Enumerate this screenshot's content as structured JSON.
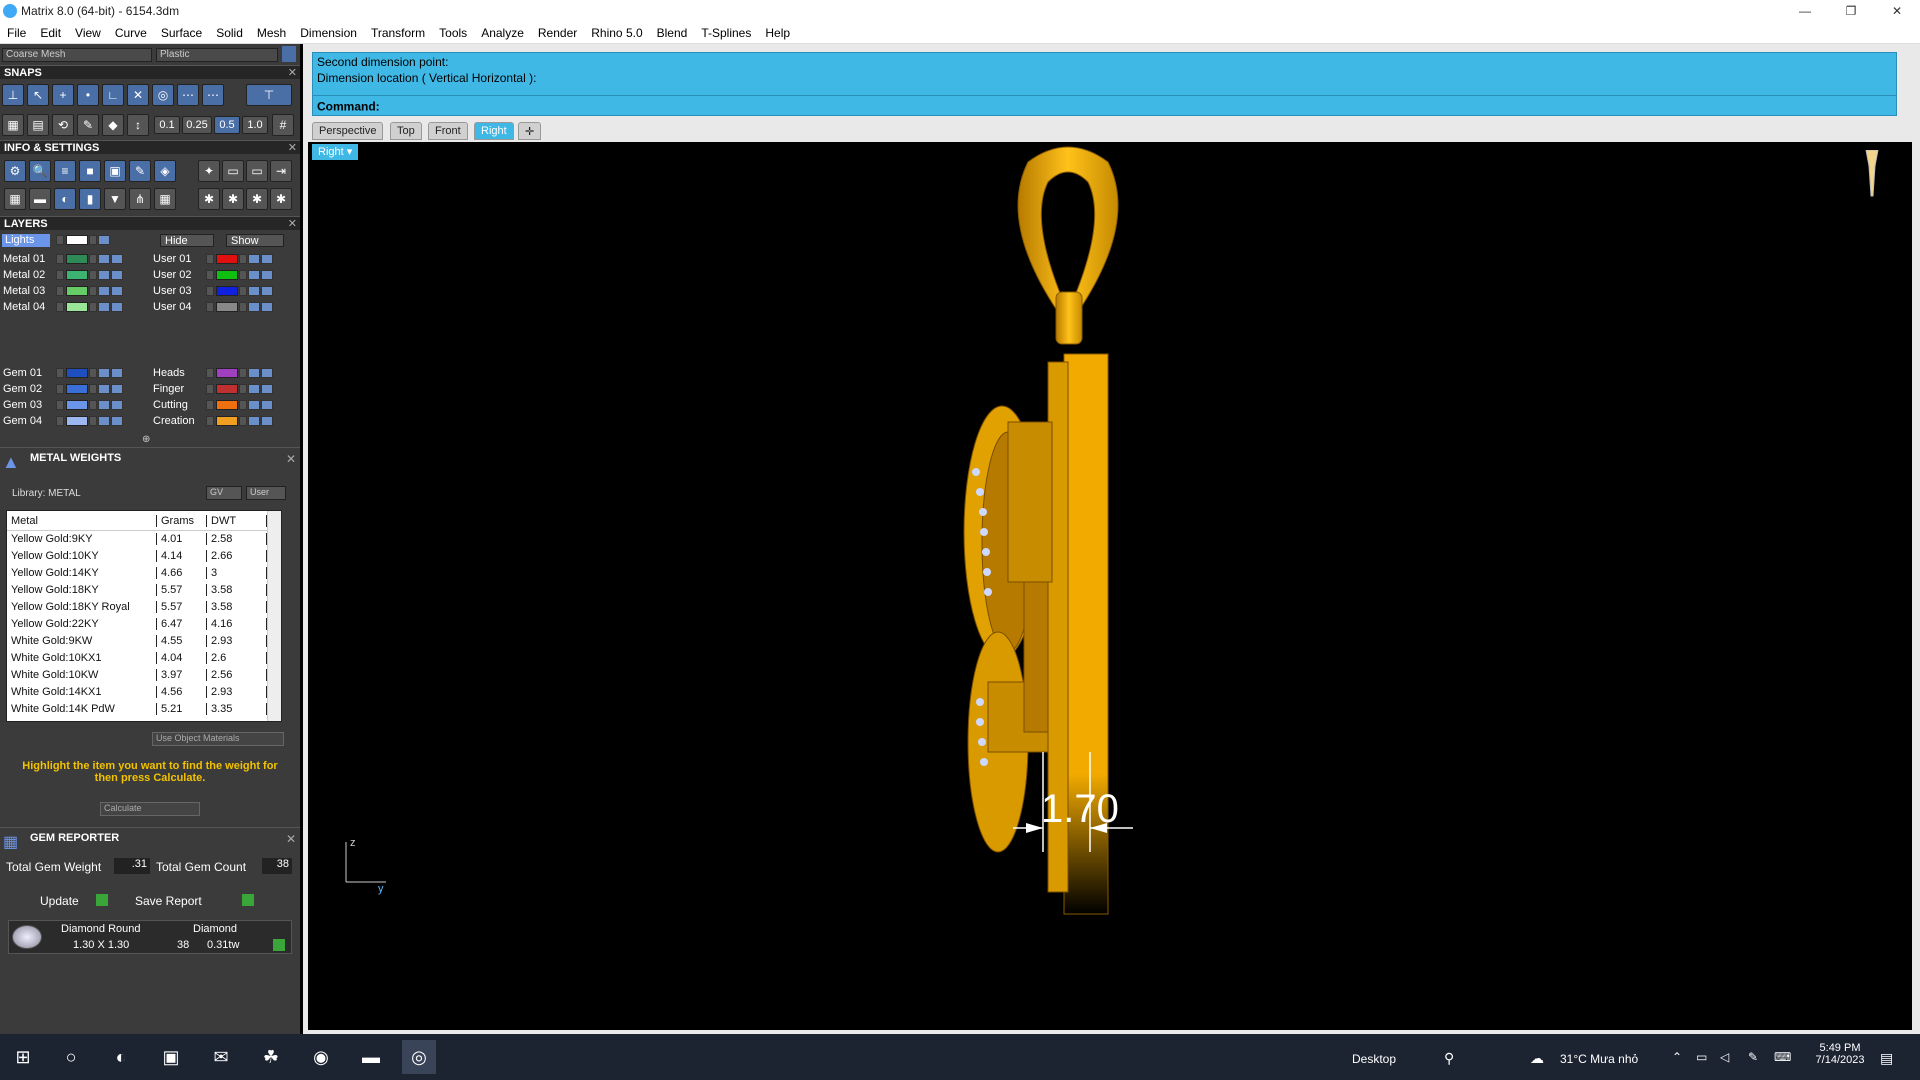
{
  "window": {
    "title": "Matrix 8.0 (64-bit) - 6154.3dm"
  },
  "menu": [
    "File",
    "Edit",
    "View",
    "Curve",
    "Surface",
    "Solid",
    "Mesh",
    "Dimension",
    "Transform",
    "Tools",
    "Analyze",
    "Render",
    "Rhino 5.0",
    "Blend",
    "T-Splines",
    "Help"
  ],
  "top_dropdowns": {
    "mesh": "Coarse Mesh",
    "material": "Plastic"
  },
  "sections": {
    "snaps": "SNAPS",
    "info": "INFO & SETTINGS",
    "layers": "LAYERS",
    "metal_weights": "METAL WEIGHTS",
    "gem_reporter": "GEM REPORTER"
  },
  "snaps": {
    "values": [
      "0.1",
      "0.25",
      "0.5",
      "1.0"
    ]
  },
  "layers": {
    "lights": "Lights",
    "hide": "Hide",
    "show": "Show",
    "left": [
      {
        "name": "Metal 01",
        "color": "#2e8b57"
      },
      {
        "name": "Metal 02",
        "color": "#3cb371"
      },
      {
        "name": "Metal 03",
        "color": "#66cc66"
      },
      {
        "name": "Metal 04",
        "color": "#99e699"
      },
      {
        "name": "Gem 01",
        "color": "#1f4fbf"
      },
      {
        "name": "Gem 02",
        "color": "#3a6fd8"
      },
      {
        "name": "Gem 03",
        "color": "#6b95e8"
      },
      {
        "name": "Gem 04",
        "color": "#9db8f0"
      }
    ],
    "right": [
      {
        "name": "User 01",
        "color": "#e01010"
      },
      {
        "name": "User 02",
        "color": "#10c010"
      },
      {
        "name": "User 03",
        "color": "#1020e0"
      },
      {
        "name": "User 04",
        "color": "#888888"
      },
      {
        "name": "Heads",
        "color": "#a040c0"
      },
      {
        "name": "Finger",
        "color": "#c03030"
      },
      {
        "name": "Cutting",
        "color": "#f07010"
      },
      {
        "name": "Creation",
        "color": "#f0a020"
      }
    ]
  },
  "metal_weights": {
    "library": "Library: METAL",
    "gv": "GV",
    "user": "User",
    "columns": [
      "Metal",
      "Grams",
      "DWT"
    ],
    "rows": [
      [
        "Yellow Gold:9KY",
        "4.01",
        "2.58"
      ],
      [
        "Yellow Gold:10KY",
        "4.14",
        "2.66"
      ],
      [
        "Yellow Gold:14KY",
        "4.66",
        "3"
      ],
      [
        "Yellow Gold:18KY",
        "5.57",
        "3.58"
      ],
      [
        "Yellow Gold:18KY Royal",
        "5.57",
        "3.58"
      ],
      [
        "Yellow Gold:22KY",
        "6.47",
        "4.16"
      ],
      [
        "White Gold:9KW",
        "4.55",
        "2.93"
      ],
      [
        "White Gold:10KX1",
        "4.04",
        "2.6"
      ],
      [
        "White Gold:10KW",
        "3.97",
        "2.56"
      ],
      [
        "White Gold:14KX1",
        "4.56",
        "2.93"
      ],
      [
        "White Gold:14K PdW",
        "5.21",
        "3.35"
      ]
    ],
    "use_object_materials": "Use Object Materials",
    "hint": "Highlight the item you want to find the weight for then press Calculate.",
    "calculate": "Calculate"
  },
  "gem_reporter": {
    "total_weight_label": "Total Gem Weight",
    "total_weight": ".31",
    "total_count_label": "Total Gem Count",
    "total_count": "38",
    "update": "Update",
    "save_report": "Save Report",
    "gem": {
      "shape": "Diamond Round",
      "size": "1.30 X 1.30",
      "type": "Diamond",
      "count": "38",
      "weight": "0.31tw"
    }
  },
  "command": {
    "line1": "Second dimension point:",
    "line2": "Dimension location ( Vertical  Horizontal ):",
    "prompt": "Command:"
  },
  "viewport_tabs": [
    "Perspective",
    "Top",
    "Front",
    "Right"
  ],
  "active_tab": "Right",
  "viewport_label": "Right",
  "dimension_value": "1.70",
  "axes": {
    "z": "z",
    "y": "y"
  },
  "taskbar": {
    "desktop": "Desktop",
    "weather": "31°C  Mưa nhỏ",
    "time": "5:49 PM",
    "date": "7/14/2023"
  },
  "colors": {
    "accent": "#3fb8e6",
    "gold": "#f5b000"
  }
}
